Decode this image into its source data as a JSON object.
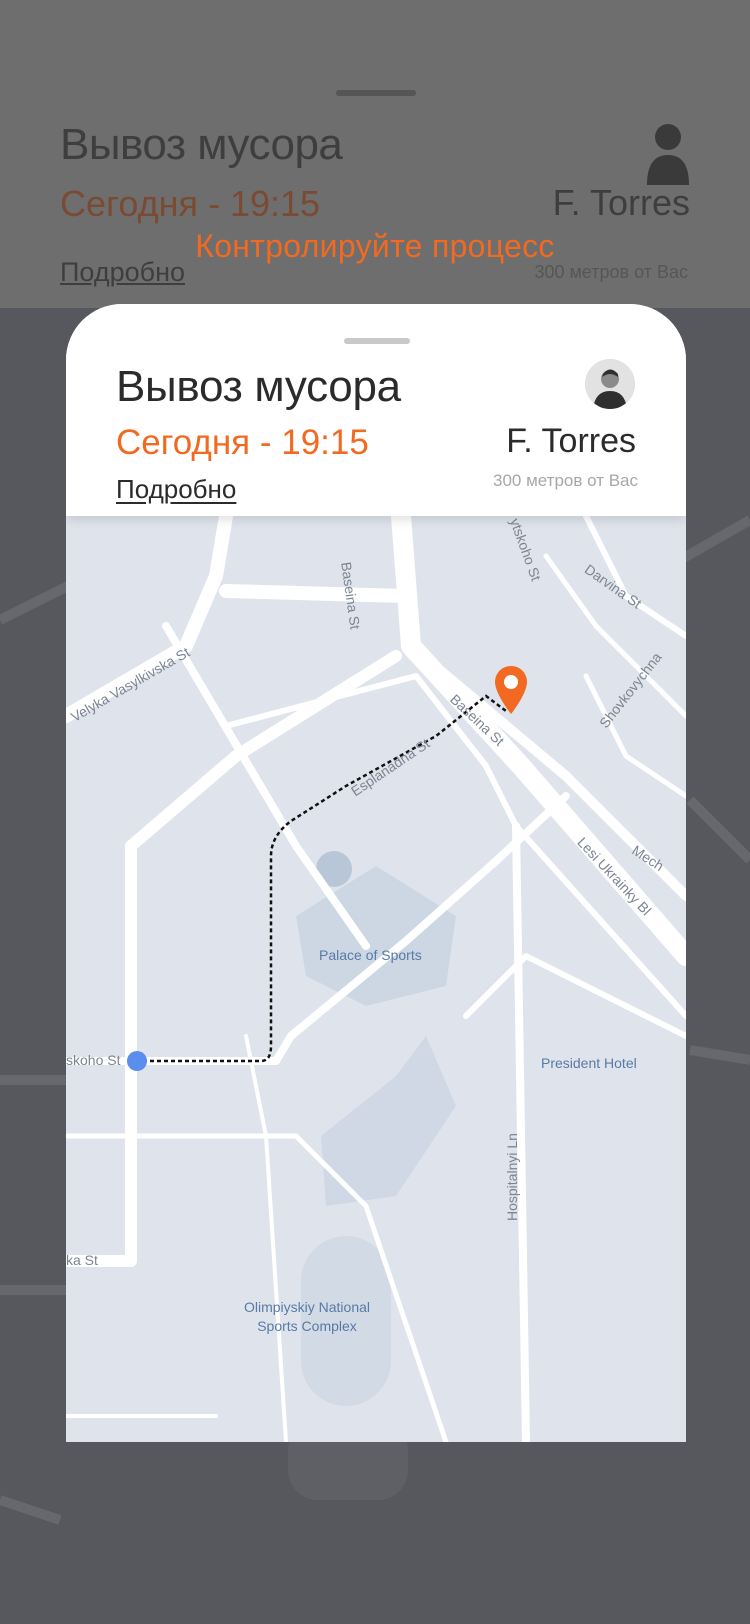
{
  "caption": "Контролируйте процесс",
  "order": {
    "title": "Вывоз мусора",
    "time": "Сегодня - 19:15",
    "details_link": "Подробно"
  },
  "driver": {
    "name": "F. Torres",
    "distance": "300 метров от Вас"
  },
  "map": {
    "streets": [
      "Baseina St",
      "Baseina St",
      "Velyka Vasylkivska St",
      "Esplanadna St",
      "Darvina St",
      "Shovkovychna",
      "Lesi Ukrainky Bl",
      "Mech",
      "ytskoho St",
      "skoho St",
      "ka St",
      "Hospitalnyi Ln"
    ],
    "places": {
      "palace": "Palace of Sports",
      "hotel": "President Hotel",
      "stadium_line1": "Olimpiyskiy National",
      "stadium_line2": "Sports Complex"
    },
    "icons": {
      "destination": "map-pin-icon",
      "origin": "current-location-icon"
    }
  },
  "colors": {
    "accent": "#f26a21",
    "location": "#5b8def"
  }
}
